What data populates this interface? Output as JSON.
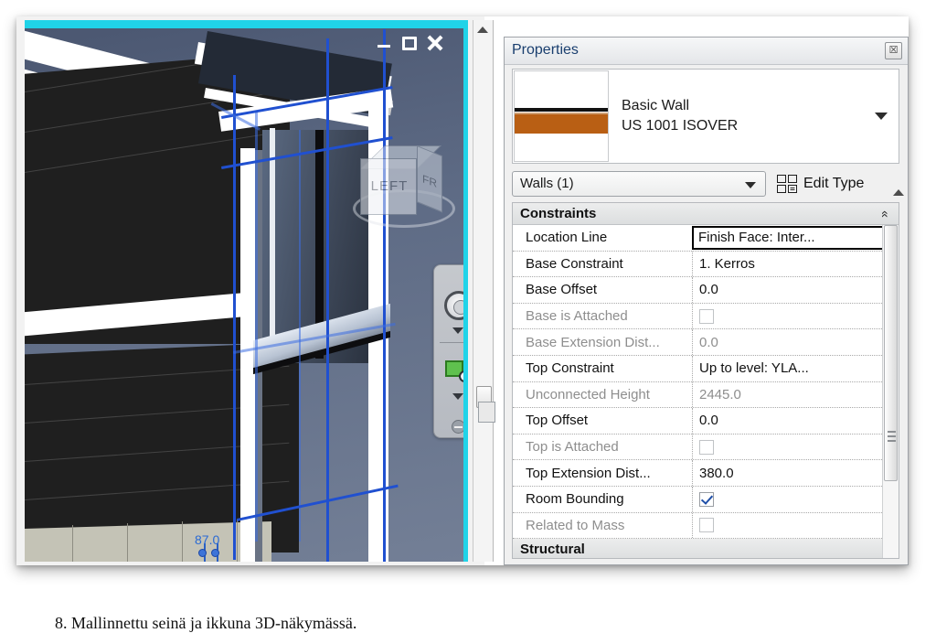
{
  "viewport": {
    "title_controls": {
      "minimize": "minimize-window",
      "restore": "restore-window",
      "close": "close-window"
    },
    "viewcube": {
      "front_label": "LEFT",
      "side_label": "FR"
    },
    "navigation_bar": {
      "close_glyph": "✖",
      "steering_wheel": "steering-wheel",
      "zoom_tool": "zoom-tool"
    },
    "dimension_label": "87.0",
    "scrollbar": {
      "up_arrow": "scroll-up"
    },
    "accent_color": "#20d3e8",
    "selection_color": "#2050d0"
  },
  "properties": {
    "title": "Properties",
    "close_glyph": "☒",
    "type_selector": {
      "family": "Basic Wall",
      "type": "US 1001 ISOVER",
      "dropdown_arrow": "▼"
    },
    "category": {
      "value": "Walls (1)",
      "edit_type_label": "Edit Type"
    },
    "groups": [
      {
        "name": "Constraints",
        "collapse_glyph": "«",
        "rows": [
          {
            "name": "Location Line",
            "value": "Finish Face: Inter...",
            "kind": "text",
            "disabled": false,
            "selected": true
          },
          {
            "name": "Base Constraint",
            "value": "1. Kerros",
            "kind": "text",
            "disabled": false,
            "selected": false
          },
          {
            "name": "Base Offset",
            "value": "0.0",
            "kind": "text",
            "disabled": false,
            "selected": false
          },
          {
            "name": "Base is Attached",
            "value": "",
            "kind": "checkbox",
            "checked": false,
            "disabled": true,
            "selected": false
          },
          {
            "name": "Base Extension Dist...",
            "value": "0.0",
            "kind": "text",
            "disabled": true,
            "selected": false
          },
          {
            "name": "Top Constraint",
            "value": "Up to level: YLA...",
            "kind": "text",
            "disabled": false,
            "selected": false
          },
          {
            "name": "Unconnected Height",
            "value": "2445.0",
            "kind": "text",
            "disabled": true,
            "selected": false
          },
          {
            "name": "Top Offset",
            "value": "0.0",
            "kind": "text",
            "disabled": false,
            "selected": false
          },
          {
            "name": "Top is Attached",
            "value": "",
            "kind": "checkbox",
            "checked": false,
            "disabled": true,
            "selected": false
          },
          {
            "name": "Top Extension Dist...",
            "value": "380.0",
            "kind": "text",
            "disabled": false,
            "selected": false
          },
          {
            "name": "Room Bounding",
            "value": "",
            "kind": "checkbox",
            "checked": true,
            "disabled": false,
            "selected": false
          },
          {
            "name": "Related to Mass",
            "value": "",
            "kind": "checkbox",
            "checked": false,
            "disabled": true,
            "selected": false
          }
        ]
      },
      {
        "name": "Structural",
        "collapse_glyph": "«",
        "rows": []
      }
    ]
  },
  "caption": {
    "text": "8. Mallinnettu seinä ja ikkuna 3D-näkymässä."
  }
}
